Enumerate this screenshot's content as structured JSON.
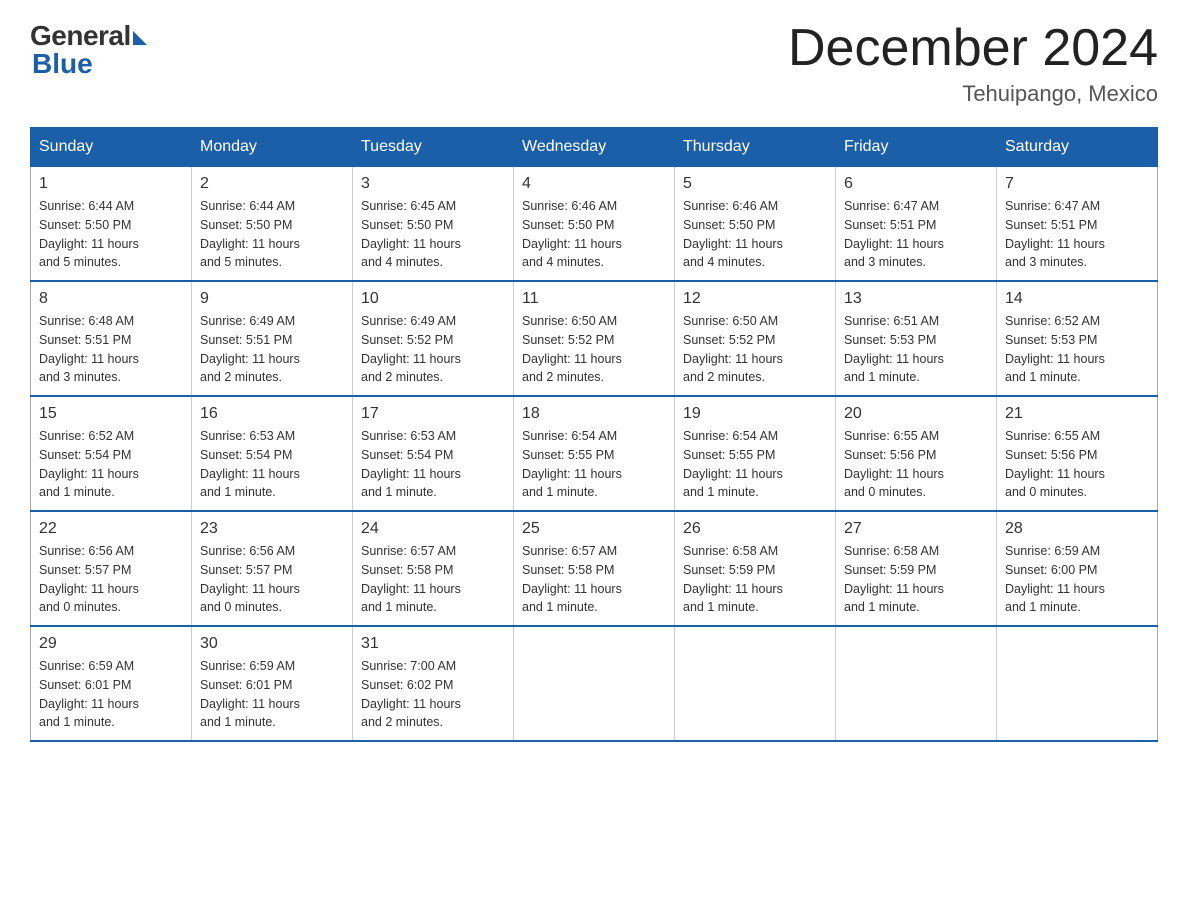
{
  "logo": {
    "general": "General",
    "blue": "Blue"
  },
  "title": "December 2024",
  "location": "Tehuipango, Mexico",
  "days_of_week": [
    "Sunday",
    "Monday",
    "Tuesday",
    "Wednesday",
    "Thursday",
    "Friday",
    "Saturday"
  ],
  "weeks": [
    [
      {
        "num": "1",
        "sunrise": "6:44 AM",
        "sunset": "5:50 PM",
        "daylight": "11 hours and 5 minutes."
      },
      {
        "num": "2",
        "sunrise": "6:44 AM",
        "sunset": "5:50 PM",
        "daylight": "11 hours and 5 minutes."
      },
      {
        "num": "3",
        "sunrise": "6:45 AM",
        "sunset": "5:50 PM",
        "daylight": "11 hours and 4 minutes."
      },
      {
        "num": "4",
        "sunrise": "6:46 AM",
        "sunset": "5:50 PM",
        "daylight": "11 hours and 4 minutes."
      },
      {
        "num": "5",
        "sunrise": "6:46 AM",
        "sunset": "5:50 PM",
        "daylight": "11 hours and 4 minutes."
      },
      {
        "num": "6",
        "sunrise": "6:47 AM",
        "sunset": "5:51 PM",
        "daylight": "11 hours and 3 minutes."
      },
      {
        "num": "7",
        "sunrise": "6:47 AM",
        "sunset": "5:51 PM",
        "daylight": "11 hours and 3 minutes."
      }
    ],
    [
      {
        "num": "8",
        "sunrise": "6:48 AM",
        "sunset": "5:51 PM",
        "daylight": "11 hours and 3 minutes."
      },
      {
        "num": "9",
        "sunrise": "6:49 AM",
        "sunset": "5:51 PM",
        "daylight": "11 hours and 2 minutes."
      },
      {
        "num": "10",
        "sunrise": "6:49 AM",
        "sunset": "5:52 PM",
        "daylight": "11 hours and 2 minutes."
      },
      {
        "num": "11",
        "sunrise": "6:50 AM",
        "sunset": "5:52 PM",
        "daylight": "11 hours and 2 minutes."
      },
      {
        "num": "12",
        "sunrise": "6:50 AM",
        "sunset": "5:52 PM",
        "daylight": "11 hours and 2 minutes."
      },
      {
        "num": "13",
        "sunrise": "6:51 AM",
        "sunset": "5:53 PM",
        "daylight": "11 hours and 1 minute."
      },
      {
        "num": "14",
        "sunrise": "6:52 AM",
        "sunset": "5:53 PM",
        "daylight": "11 hours and 1 minute."
      }
    ],
    [
      {
        "num": "15",
        "sunrise": "6:52 AM",
        "sunset": "5:54 PM",
        "daylight": "11 hours and 1 minute."
      },
      {
        "num": "16",
        "sunrise": "6:53 AM",
        "sunset": "5:54 PM",
        "daylight": "11 hours and 1 minute."
      },
      {
        "num": "17",
        "sunrise": "6:53 AM",
        "sunset": "5:54 PM",
        "daylight": "11 hours and 1 minute."
      },
      {
        "num": "18",
        "sunrise": "6:54 AM",
        "sunset": "5:55 PM",
        "daylight": "11 hours and 1 minute."
      },
      {
        "num": "19",
        "sunrise": "6:54 AM",
        "sunset": "5:55 PM",
        "daylight": "11 hours and 1 minute."
      },
      {
        "num": "20",
        "sunrise": "6:55 AM",
        "sunset": "5:56 PM",
        "daylight": "11 hours and 0 minutes."
      },
      {
        "num": "21",
        "sunrise": "6:55 AM",
        "sunset": "5:56 PM",
        "daylight": "11 hours and 0 minutes."
      }
    ],
    [
      {
        "num": "22",
        "sunrise": "6:56 AM",
        "sunset": "5:57 PM",
        "daylight": "11 hours and 0 minutes."
      },
      {
        "num": "23",
        "sunrise": "6:56 AM",
        "sunset": "5:57 PM",
        "daylight": "11 hours and 0 minutes."
      },
      {
        "num": "24",
        "sunrise": "6:57 AM",
        "sunset": "5:58 PM",
        "daylight": "11 hours and 1 minute."
      },
      {
        "num": "25",
        "sunrise": "6:57 AM",
        "sunset": "5:58 PM",
        "daylight": "11 hours and 1 minute."
      },
      {
        "num": "26",
        "sunrise": "6:58 AM",
        "sunset": "5:59 PM",
        "daylight": "11 hours and 1 minute."
      },
      {
        "num": "27",
        "sunrise": "6:58 AM",
        "sunset": "5:59 PM",
        "daylight": "11 hours and 1 minute."
      },
      {
        "num": "28",
        "sunrise": "6:59 AM",
        "sunset": "6:00 PM",
        "daylight": "11 hours and 1 minute."
      }
    ],
    [
      {
        "num": "29",
        "sunrise": "6:59 AM",
        "sunset": "6:01 PM",
        "daylight": "11 hours and 1 minute."
      },
      {
        "num": "30",
        "sunrise": "6:59 AM",
        "sunset": "6:01 PM",
        "daylight": "11 hours and 1 minute."
      },
      {
        "num": "31",
        "sunrise": "7:00 AM",
        "sunset": "6:02 PM",
        "daylight": "11 hours and 2 minutes."
      },
      null,
      null,
      null,
      null
    ]
  ],
  "labels": {
    "sunrise": "Sunrise:",
    "sunset": "Sunset:",
    "daylight": "Daylight:"
  }
}
